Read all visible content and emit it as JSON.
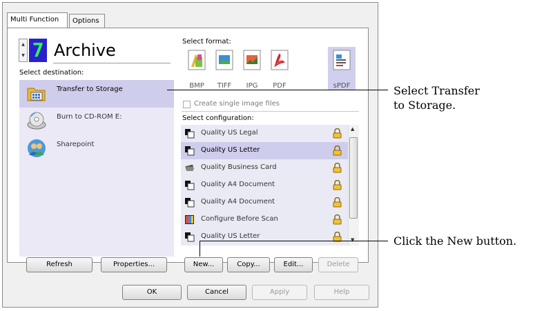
{
  "tabs": [
    "Multi Function",
    "Options"
  ],
  "profile": {
    "number": "7",
    "name": "Archive"
  },
  "labels": {
    "select_destination": "Select destination:",
    "select_format": "Select format:",
    "select_configuration": "Select configuration:",
    "create_single": "Create single image files"
  },
  "destinations": [
    {
      "label": "Transfer to Storage",
      "icon": "storage-folder-icon",
      "selected": true
    },
    {
      "label": "Burn to CD-ROM  E:",
      "icon": "cd-rom-icon",
      "selected": false
    },
    {
      "label": "Sharepoint",
      "icon": "sharepoint-icon",
      "selected": false
    }
  ],
  "formats": [
    {
      "label": "BMP",
      "icon": "bmp-format-icon"
    },
    {
      "label": "TIFF",
      "icon": "tiff-format-icon"
    },
    {
      "label": "JPG",
      "icon": "jpg-format-icon"
    },
    {
      "label": "PDF",
      "icon": "pdf-format-icon"
    },
    {
      "label": "sPDF",
      "icon": "spdf-format-icon",
      "selected": true
    }
  ],
  "configurations": [
    {
      "label": "Quality US Legal",
      "icon": "document-icon"
    },
    {
      "label": "Quality US Letter",
      "icon": "document-icon",
      "selected": true
    },
    {
      "label": "Quality Business Card",
      "icon": "business-card-icon"
    },
    {
      "label": "Quality A4 Document",
      "icon": "document-icon"
    },
    {
      "label": "Quality A4 Document",
      "icon": "document-icon"
    },
    {
      "label": "Configure Before Scan",
      "icon": "configure-icon"
    },
    {
      "label": "Quality US Letter",
      "icon": "document-icon"
    }
  ],
  "buttons": {
    "refresh": "Refresh",
    "properties": "Properties...",
    "new": "New...",
    "copy": "Copy...",
    "edit": "Edit...",
    "delete": "Delete",
    "ok": "OK",
    "cancel": "Cancel",
    "apply": "Apply",
    "help": "Help"
  },
  "callouts": {
    "select_transfer_line1": "Select Transfer",
    "select_transfer_line2": "to Storage.",
    "click_new": "Click the New button."
  },
  "colors": {
    "selection": "#cfcdec",
    "lcd_bg": "#2b20ce",
    "lcd_fg": "#29ff4a"
  }
}
